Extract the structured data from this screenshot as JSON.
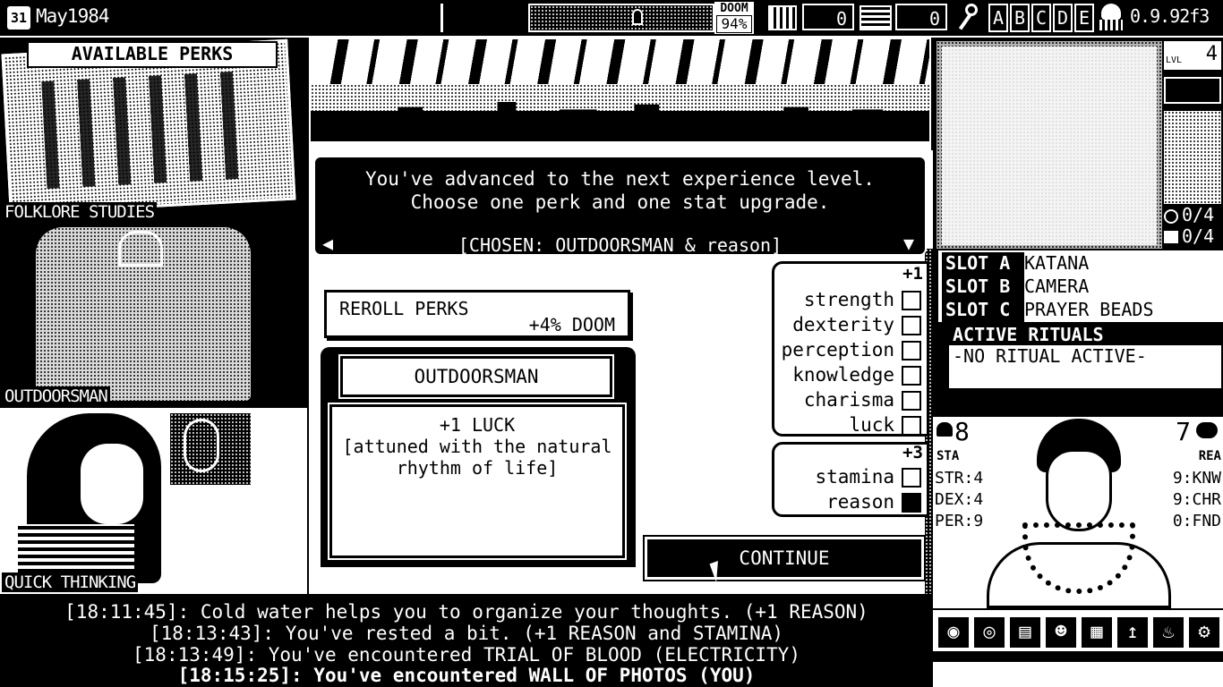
{
  "topbar": {
    "calendar_day": "31",
    "date": "May1984",
    "doom_label": "DOOM",
    "doom_value": "94%",
    "funds_value": "0",
    "saves_value": "0",
    "key_letters": [
      "A",
      "B",
      "C",
      "D",
      "E"
    ],
    "version": "0.9.92f3"
  },
  "left_panels": [
    {
      "label": "FOLKLORE STUDIES",
      "header": "AVAILABLE PERKS"
    },
    {
      "label": "OUTDOORSMAN"
    },
    {
      "label": "QUICK THINKING"
    }
  ],
  "dialog": {
    "line1": "You've advanced to the next experience level.",
    "line2": "Choose one perk and one stat upgrade.",
    "chosen": "[CHOSEN: OUTDOORSMAN & reason]",
    "reroll_label": "REROLL PERKS",
    "reroll_cost": "+4% DOOM",
    "perk_title": "OUTDOORSMAN",
    "perk_line1": "+1 LUCK",
    "perk_line2": "[attuned with the natural",
    "perk_line3": "rhythm of life]",
    "continue_label": "CONTINUE",
    "stats_a_bonus": "+1",
    "stats_a": [
      {
        "name": "strength",
        "checked": false
      },
      {
        "name": "dexterity",
        "checked": false
      },
      {
        "name": "perception",
        "checked": false
      },
      {
        "name": "knowledge",
        "checked": false
      },
      {
        "name": "charisma",
        "checked": false
      },
      {
        "name": "luck",
        "checked": false
      }
    ],
    "stats_b_bonus": "+3",
    "stats_b": [
      {
        "name": "stamina",
        "checked": false
      },
      {
        "name": "reason",
        "checked": true
      }
    ]
  },
  "log": [
    "[18:11:45]: Cold water helps you to organize your thoughts. (+1 REASON)",
    "[18:13:43]: You've rested a bit. (+1 REASON and STAMINA)",
    "[18:13:49]: You've encountered TRIAL OF BLOOD (ELECTRICITY)",
    "[18:15:25]: You've encountered WALL OF PHOTOS (YOU)"
  ],
  "right": {
    "level_label": "LVL",
    "level_value": "4",
    "counter1": "0/4",
    "counter2": "0/4",
    "slots": [
      {
        "key": "SLOT A",
        "value": "KATANA"
      },
      {
        "key": "SLOT B",
        "value": "CAMERA"
      },
      {
        "key": "SLOT C",
        "value": "PRAYER BEADS"
      }
    ],
    "rituals_title": "ACTIVE RITUALS",
    "rituals_text": "-NO RITUAL ACTIVE-",
    "sta_value": "8",
    "sta_label": "STA",
    "rea_value": "7",
    "rea_label": "REA",
    "stats_left": [
      "STR:4",
      "DEX:4",
      "PER:9"
    ],
    "stats_right": [
      "9:KNW",
      "9:CHR",
      "0:FND"
    ]
  }
}
